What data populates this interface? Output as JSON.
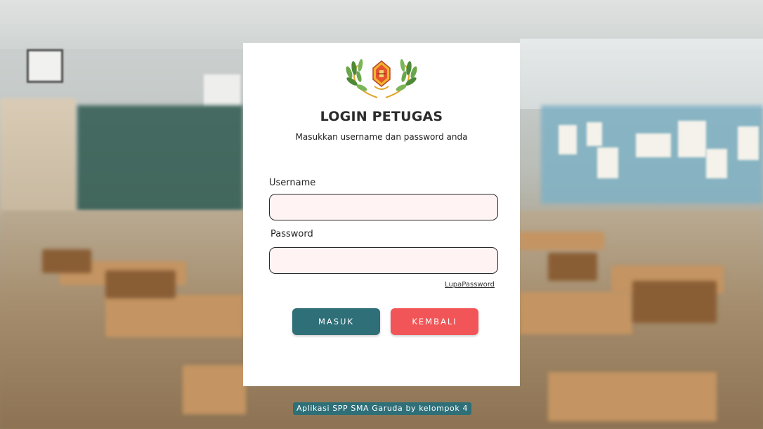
{
  "login_card": {
    "title": "LOGIN PETUGAS",
    "subtitle": "Masukkan username dan password anda",
    "username_label": "Username",
    "username_value": "",
    "password_label": "Password",
    "password_value": "",
    "forgot_link": "LupaPassword",
    "submit_button": "MASUK",
    "back_button": "KEMBALI"
  },
  "footer": {
    "text": "Aplikasi SPP SMA Garuda by kelompok 4"
  },
  "icons": {
    "logo": "school-crest-logo"
  },
  "colors": {
    "primary": "#2e6f78",
    "danger": "#f25557",
    "input_bg": "#fff3f3",
    "card_bg": "#ffffff"
  }
}
